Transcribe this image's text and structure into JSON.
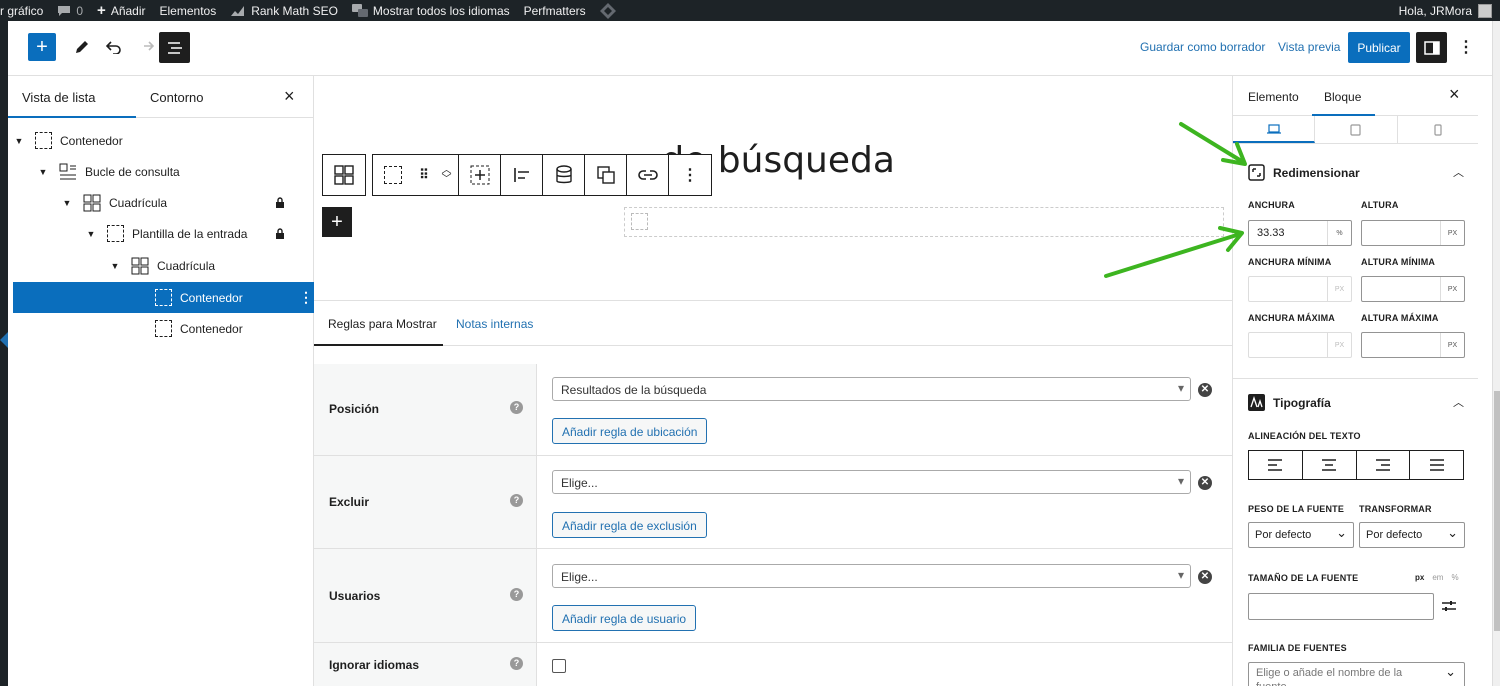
{
  "admin_bar": {
    "item_grafico": "r gráfico",
    "comments_count": "0",
    "add_new": "Añadir",
    "elementos": "Elementos",
    "rank_math": "Rank Math SEO",
    "languages": "Mostrar todos los idiomas",
    "perfmatters": "Perfmatters",
    "greeting": "Hola, JRMora"
  },
  "header": {
    "save_draft": "Guardar como borrador",
    "preview": "Vista previa",
    "publish": "Publicar"
  },
  "list_panel": {
    "tab_list": "Vista de lista",
    "tab_outline": "Contorno",
    "items": [
      {
        "label": "Contenedor"
      },
      {
        "label": "Bucle de consulta"
      },
      {
        "label": "Cuadrícula"
      },
      {
        "label": "Plantilla de la entrada"
      },
      {
        "label": "Cuadrícula"
      },
      {
        "label": "Contenedor"
      },
      {
        "label": "Contenedor"
      }
    ]
  },
  "canvas": {
    "title": "Cuadro resultados de búsqueda",
    "title_visible": "de búsqueda"
  },
  "meta": {
    "tab_rules": "Reglas para Mostrar",
    "tab_notes": "Notas internas",
    "rows": [
      {
        "label": "Posición",
        "select": "Resultados de la búsqueda",
        "button": "Añadir regla de ubicación"
      },
      {
        "label": "Excluir",
        "select": "Elige...",
        "button": "Añadir regla de exclusión"
      },
      {
        "label": "Usuarios",
        "select": "Elige...",
        "button": "Añadir regla de usuario"
      },
      {
        "label": "Ignorar idiomas"
      }
    ]
  },
  "sidebar": {
    "tab_element": "Elemento",
    "tab_block": "Bloque",
    "resize": {
      "title": "Redimensionar",
      "width_label": "ANCHURA",
      "width_value": "33.33",
      "width_unit": "%",
      "height_label": "ALTURA",
      "height_unit": "PX",
      "min_width_label": "ANCHURA MÍNIMA",
      "min_height_label": "ALTURA MÍNIMA",
      "max_width_label": "ANCHURA MÁXIMA",
      "max_height_label": "ALTURA MÁXIMA",
      "unit_px": "PX"
    },
    "typography": {
      "title": "Tipografía",
      "align_label": "ALINEACIÓN DEL TEXTO",
      "weight_label": "PESO DE LA FUENTE",
      "weight_value": "Por defecto",
      "transform_label": "TRANSFORMAR",
      "transform_value": "Por defecto",
      "size_label": "TAMAÑO DE LA FUENTE",
      "unit_px": "px",
      "unit_em": "em",
      "unit_pct": "%",
      "family_label": "FAMILIA DE FUENTES",
      "family_placeholder": "Elige o añade el nombre de la fuente"
    }
  },
  "colors": {
    "accent": "#2271b1",
    "selected": "#0a6ebd",
    "annotation": "#3db520"
  }
}
